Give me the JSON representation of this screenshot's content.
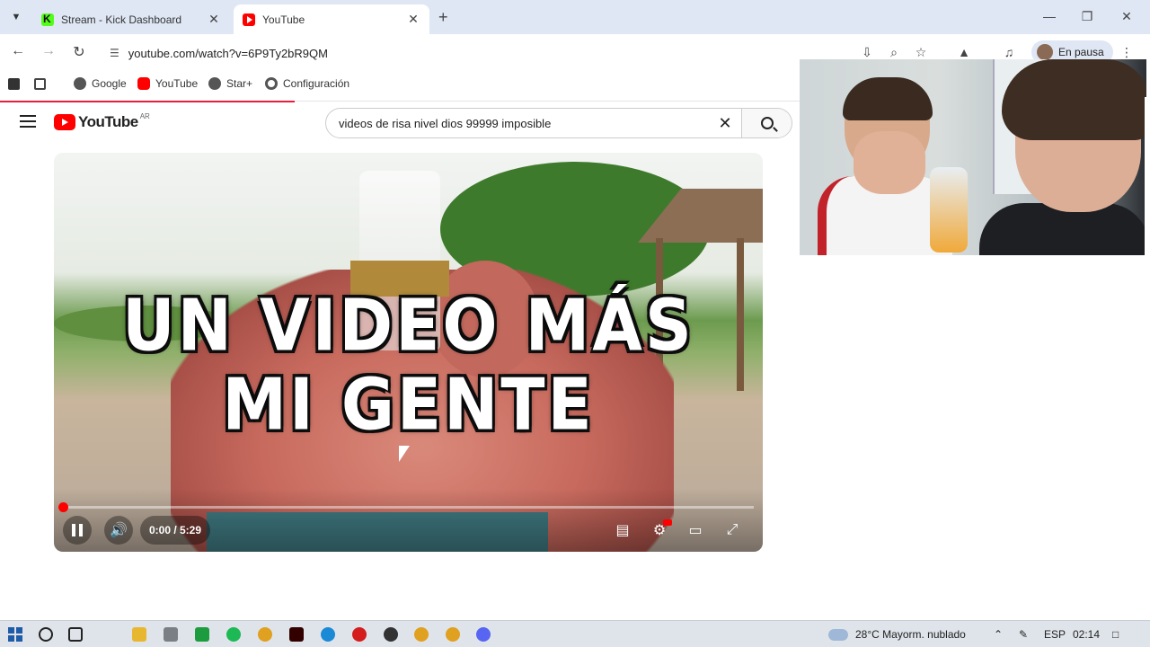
{
  "browser": {
    "tabs": [
      {
        "title": "Stream - Kick Dashboard",
        "active": false
      },
      {
        "title": "YouTube",
        "active": true
      }
    ],
    "url": "youtube.com/watch?v=6P9Ty2bR9QM",
    "profile_label": "En pausa",
    "bookmarks": [
      "Google",
      "YouTube",
      "Star+",
      "Configuración"
    ]
  },
  "youtube": {
    "logo_text": "YouTube",
    "country_code": "AR",
    "search_query": "videos de risa nivel dios 99999 imposible"
  },
  "player": {
    "overlay_line1": "UN VIDEO MÁS",
    "overlay_line2": "MI GENTE",
    "time_display": "0:00 / 5:29",
    "progress_fraction": 0.0,
    "accent_color": "#ff0000"
  },
  "taskbar": {
    "weather": "28°C  Mayorm. nublado",
    "language": "ESP",
    "clock": "02:14"
  }
}
